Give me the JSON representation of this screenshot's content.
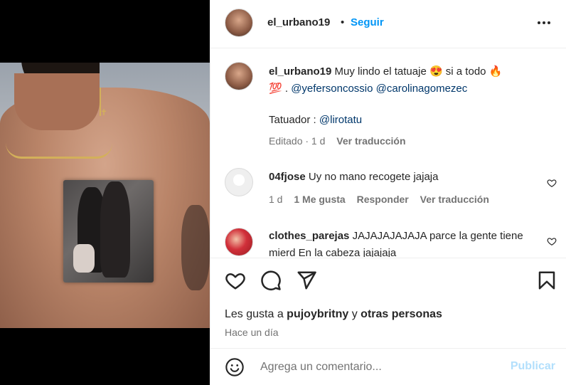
{
  "post": {
    "username": "el_urbano19",
    "separator": "•",
    "follow_label": "Seguir",
    "more_icon": "more-horizontal-icon"
  },
  "caption": {
    "username": "el_urbano19",
    "text_1": "Muy lindo el tatuaje 😍  si a todo 🔥",
    "text_2": "💯 . ",
    "mention_1": "@yefersoncossio",
    "mention_2": "@carolinagomezec",
    "tattoo_label": "Tatuador : ",
    "tattoo_mention": "@lirotatu",
    "edited": "Editado · 1 d",
    "translate": "Ver traducción"
  },
  "comments": [
    {
      "username": "04fjose",
      "text": "Uy no mano recogete jajaja",
      "time": "1 d",
      "likes": "1 Me gusta",
      "reply": "Responder",
      "translate": "Ver traducción"
    },
    {
      "username": "clothes_parejas",
      "text": "JAJAJAJAJAJA parce la gente tiene mierd  En la cabeza jajajaja"
    }
  ],
  "actions": {
    "like_icon": "heart-icon",
    "comment_icon": "comment-icon",
    "share_icon": "share-icon",
    "save_icon": "bookmark-icon"
  },
  "likes": {
    "prefix": "Les gusta a ",
    "user": "pujoybritny",
    "connector": " y ",
    "others": "otras personas"
  },
  "time_ago": "Hace un día",
  "add_comment": {
    "placeholder": "Agrega un comentario...",
    "emoji_icon": "emoji-icon",
    "publish_label": "Publicar"
  }
}
